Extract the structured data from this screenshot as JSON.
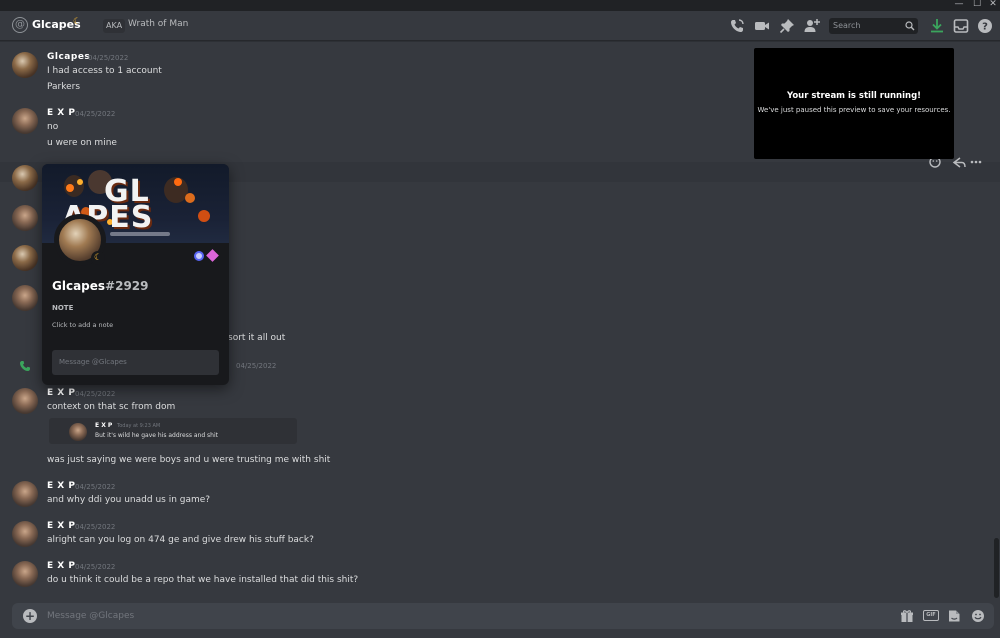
{
  "window": {
    "minimize": "—",
    "maximize": "☐",
    "close": "✕"
  },
  "header": {
    "username": "Glcapes",
    "status_emoji": "☾",
    "aka_label": "AKA",
    "nickname": "Wrath of Man",
    "search_placeholder": "Search",
    "icons": [
      "call-icon",
      "video-icon",
      "pin-icon",
      "add-friend-icon",
      "search-icon",
      "download-icon",
      "inbox-icon",
      "help-icon"
    ]
  },
  "messages": [
    {
      "author": "Glcapes",
      "time": "04/25/2022",
      "lines": [
        "I had access to 1 account",
        "Parkers"
      ]
    },
    {
      "author": "E X P",
      "time": "04/25/2022",
      "lines": [
        "no",
        "u were on mine"
      ]
    },
    {
      "author": "",
      "time": "",
      "lines": [
        "sort it all out"
      ]
    },
    {
      "author": "",
      "time": "04/25/2022",
      "lines": []
    },
    {
      "author": "E X P",
      "time": "04/25/2022",
      "lines": [
        "context on that sc from dom",
        "was just saying we were boys and u were trusting me with shit"
      ]
    },
    {
      "author": "E X P",
      "time": "04/25/2022",
      "lines": [
        "and why ddi you unadd us in game?"
      ]
    },
    {
      "author": "E X P",
      "time": "04/25/2022",
      "lines": [
        "alright can you log on 474 ge and give drew his stuff back?"
      ]
    },
    {
      "author": "E X P",
      "time": "04/25/2022",
      "lines": [
        "do u think it could be a repo that we have installed that did this shit?"
      ]
    }
  ],
  "reply": {
    "author": "E X P",
    "time": "Today at 9:23 AM",
    "text": "But it's wild he gave his address and shit"
  },
  "stream": {
    "title": "Your stream is still running!",
    "subtitle": "We've just paused this preview to save your resources."
  },
  "profile": {
    "banner_line1": "GL",
    "banner_line2": "APES",
    "name": "Glcapes",
    "discriminator": "#2929",
    "note_label": "NOTE",
    "note_placeholder": "Click to add a note",
    "message_placeholder": "Message @Glcapes"
  },
  "composer": {
    "placeholder": "Message @Glcapes",
    "gif_label": "GIF"
  },
  "colors": {
    "background": "#36393f",
    "popout": "#18191c",
    "accent": "#5865f2",
    "idle": "#f0b232",
    "call_green": "#3ba55d"
  }
}
